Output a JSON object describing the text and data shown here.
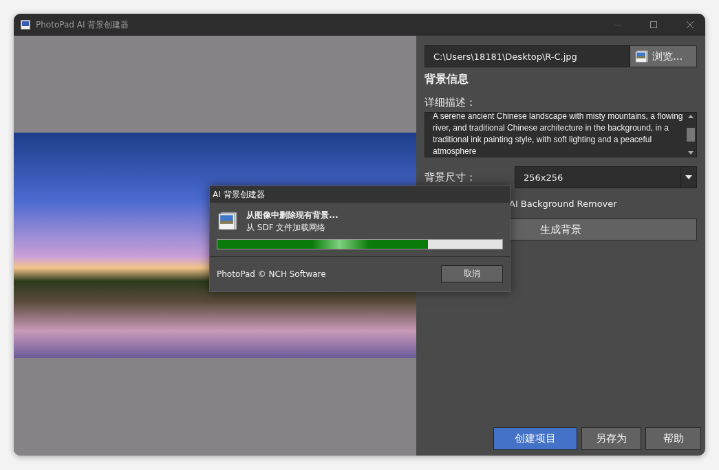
{
  "window": {
    "title": "PhotoPad AI 背景创建器"
  },
  "file": {
    "path": "C:\\Users\\18181\\Desktop\\R-C.jpg",
    "browse_button": "浏览..."
  },
  "section_title": "背景信息",
  "description": {
    "label": "详细描述：",
    "value": "A serene ancient Chinese landscape with misty mountains, a flowing river, and traditional Chinese architecture in the background, in a traditional ink painting style, with soft lighting and a peaceful atmosphere"
  },
  "size": {
    "label": "背景尺寸：",
    "value": "256x256"
  },
  "remover_option": {
    "label": "AI Background Remover"
  },
  "generate_button": "生成背景",
  "footer_buttons": [
    {
      "label": "创建项目",
      "primary": true
    },
    {
      "label": "另存为",
      "primary": false
    },
    {
      "label": "帮助",
      "primary": false
    }
  ],
  "dialog": {
    "title": "AI 背景创建器",
    "heading": "从图像中删除现有背景...",
    "subtext": "从 SDF 文件加载网络",
    "progress": {
      "level": 0.74
    },
    "footer_text": "PhotoPad © NCH Software",
    "cancel_button": "取消"
  }
}
